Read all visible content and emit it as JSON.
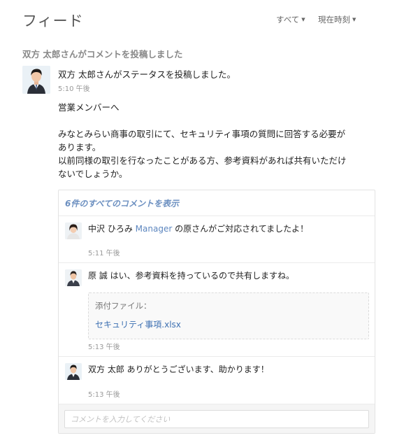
{
  "header": {
    "title": "フィード",
    "filter_all": "すべて",
    "filter_time": "現在時刻"
  },
  "activity_title": "双方 太郎さんがコメントを投稿しました",
  "post": {
    "author_line": "双方 太郎さんがステータスを投稿しました。",
    "time": "5:10 午後",
    "body": [
      "営業メンバーへ",
      "みなとみらい商事の取引にて、セキュリティ事項の質問に回答する必要が",
      "あります。",
      "以前同様の取引を行なったことがある方、参考資料があれば共有いただけ",
      "ないでしょうか。"
    ]
  },
  "comments": {
    "show_all": "6件のすべてのコメントを表示",
    "items": [
      {
        "author": "中沢 ひろみ",
        "mention": "Manager",
        "text": "の原さんがご対応されてましたよ！",
        "time": "5:11 午後"
      },
      {
        "author": "原 誠",
        "text": "はい、参考資料を持っているので共有しますね。",
        "attachment_label": "添付ファイル：",
        "attachment_file": "セキュリティ事項.xlsx",
        "time": "5:13 午後"
      },
      {
        "author": "双方 太郎",
        "text": "ありがとうございます、助かります！",
        "time": "5:13 午後"
      }
    ],
    "input_placeholder": "コメントを入力してください"
  },
  "icons": {
    "caret": "caret-down-icon",
    "avatar": "user-photo"
  },
  "colors": {
    "link": "#5c86bf",
    "file_link": "#3d70b2",
    "muted": "#999999"
  }
}
